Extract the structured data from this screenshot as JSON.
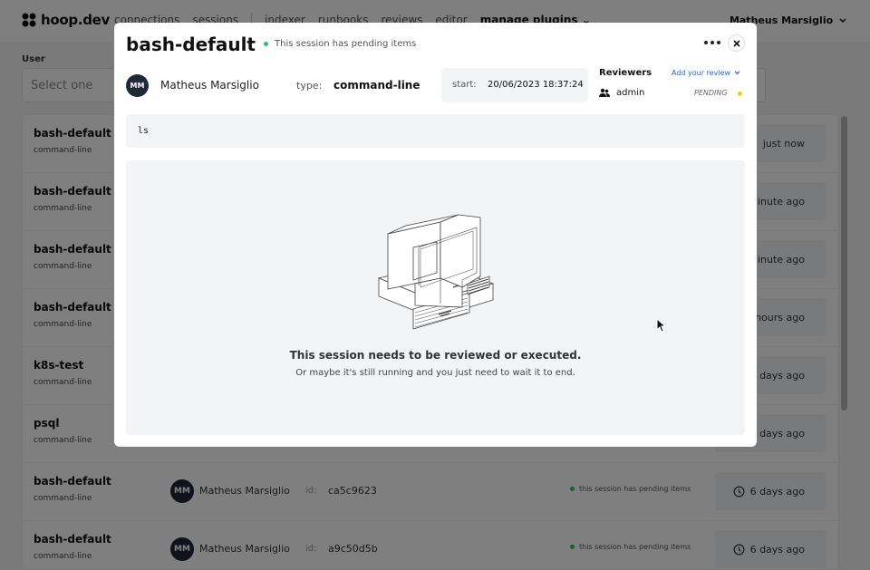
{
  "app": {
    "logo_text": "hoop.dev"
  },
  "nav": {
    "items": [
      "connections",
      "sessions",
      "indexer",
      "runbooks",
      "reviews",
      "editor"
    ],
    "plugins_label": "manage plugins",
    "user_name": "Matheus Marsiglio"
  },
  "filters": {
    "user_label": "User",
    "user_placeholder": "Select one"
  },
  "sessions": [
    {
      "name": "bash-default",
      "type": "command-line",
      "time": "just now"
    },
    {
      "name": "bash-default",
      "type": "command-line",
      "time": "minute ago"
    },
    {
      "name": "bash-default",
      "type": "command-line",
      "time": "minute ago"
    },
    {
      "name": "bash-default",
      "type": "command-line",
      "time": "hours ago"
    },
    {
      "name": "k8s-test",
      "type": "command-line",
      "time": "days ago"
    },
    {
      "name": "psql",
      "type": "command-line",
      "time": "days ago"
    },
    {
      "name": "bash-default",
      "type": "command-line",
      "user_initials": "MM",
      "user": "Matheus Marsiglio",
      "id_label": "id:",
      "id": "ca5c9623",
      "status": "this session has pending items",
      "time": "6 days ago"
    },
    {
      "name": "bash-default",
      "type": "command-line",
      "user_initials": "MM",
      "user": "Matheus Marsiglio",
      "id_label": "id:",
      "id": "a9c50d5b",
      "status": "this session has pending items",
      "time": "6 days ago"
    }
  ],
  "modal": {
    "title": "bash-default",
    "pending_text": "This session has pending items",
    "user_initials": "MM",
    "user_name": "Matheus Marsiglio",
    "type_label": "type:",
    "type_value": "command-line",
    "start_label": "start:",
    "start_value": "20/06/2023 18:37:24",
    "reviewers_title": "Reviewers",
    "add_review_label": "Add your review",
    "reviewers": [
      {
        "name": "admin",
        "status": "PENDING"
      }
    ],
    "script": "ls",
    "empty_title": "This session needs to be reviewed or executed.",
    "empty_subtitle": "Or maybe it's still running and you just need to wait it to end."
  },
  "colors": {
    "status_green": "#22c55e",
    "pending_yellow": "#facc15",
    "link_blue": "#2563eb",
    "avatar_dark": "#1f2937"
  }
}
